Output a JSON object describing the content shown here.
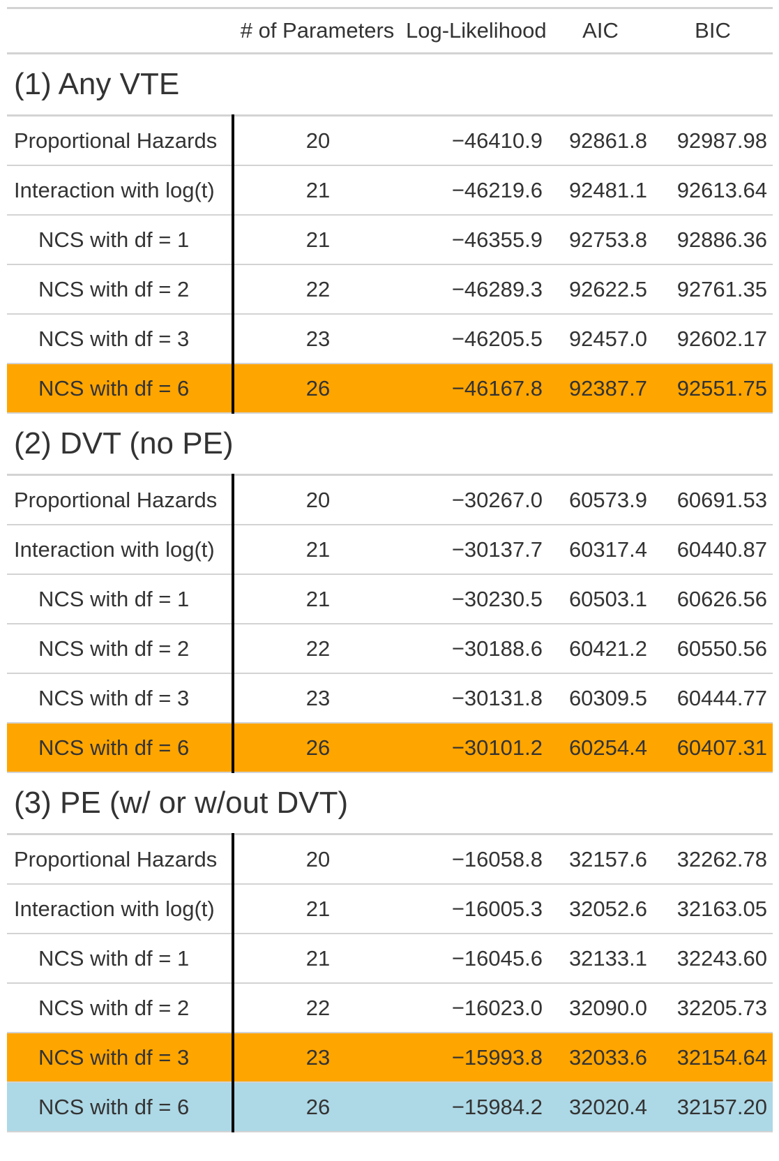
{
  "table": {
    "columns": [
      "",
      "# of Parameters",
      "Log-Likelihood",
      "AIC",
      "BIC"
    ],
    "groups": [
      {
        "title": "(1) Any VTE",
        "rows": [
          {
            "label": "Proportional Hazards",
            "indent": 0,
            "params": "20",
            "loglik": "−46410.9",
            "aic": "92861.8",
            "bic": "92987.98",
            "highlight": ""
          },
          {
            "label": "Interaction with log(t)",
            "indent": 0,
            "params": "21",
            "loglik": "−46219.6",
            "aic": "92481.1",
            "bic": "92613.64",
            "highlight": ""
          },
          {
            "label": "NCS with df = 1",
            "indent": 1,
            "params": "21",
            "loglik": "−46355.9",
            "aic": "92753.8",
            "bic": "92886.36",
            "highlight": ""
          },
          {
            "label": "NCS with df = 2",
            "indent": 1,
            "params": "22",
            "loglik": "−46289.3",
            "aic": "92622.5",
            "bic": "92761.35",
            "highlight": ""
          },
          {
            "label": "NCS with df = 3",
            "indent": 1,
            "params": "23",
            "loglik": "−46205.5",
            "aic": "92457.0",
            "bic": "92602.17",
            "highlight": ""
          },
          {
            "label": "NCS with df = 6",
            "indent": 1,
            "params": "26",
            "loglik": "−46167.8",
            "aic": "92387.7",
            "bic": "92551.75",
            "highlight": "orange"
          }
        ]
      },
      {
        "title": "(2) DVT (no PE)",
        "rows": [
          {
            "label": "Proportional Hazards",
            "indent": 0,
            "params": "20",
            "loglik": "−30267.0",
            "aic": "60573.9",
            "bic": "60691.53",
            "highlight": ""
          },
          {
            "label": "Interaction with log(t)",
            "indent": 0,
            "params": "21",
            "loglik": "−30137.7",
            "aic": "60317.4",
            "bic": "60440.87",
            "highlight": ""
          },
          {
            "label": "NCS with df = 1",
            "indent": 1,
            "params": "21",
            "loglik": "−30230.5",
            "aic": "60503.1",
            "bic": "60626.56",
            "highlight": ""
          },
          {
            "label": "NCS with df = 2",
            "indent": 1,
            "params": "22",
            "loglik": "−30188.6",
            "aic": "60421.2",
            "bic": "60550.56",
            "highlight": ""
          },
          {
            "label": "NCS with df = 3",
            "indent": 1,
            "params": "23",
            "loglik": "−30131.8",
            "aic": "60309.5",
            "bic": "60444.77",
            "highlight": ""
          },
          {
            "label": "NCS with df = 6",
            "indent": 1,
            "params": "26",
            "loglik": "−30101.2",
            "aic": "60254.4",
            "bic": "60407.31",
            "highlight": "orange"
          }
        ]
      },
      {
        "title": "(3) PE (w/ or w/out DVT)",
        "rows": [
          {
            "label": "Proportional Hazards",
            "indent": 0,
            "params": "20",
            "loglik": "−16058.8",
            "aic": "32157.6",
            "bic": "32262.78",
            "highlight": ""
          },
          {
            "label": "Interaction with log(t)",
            "indent": 0,
            "params": "21",
            "loglik": "−16005.3",
            "aic": "32052.6",
            "bic": "32163.05",
            "highlight": ""
          },
          {
            "label": "NCS with df = 1",
            "indent": 1,
            "params": "21",
            "loglik": "−16045.6",
            "aic": "32133.1",
            "bic": "32243.60",
            "highlight": ""
          },
          {
            "label": "NCS with df = 2",
            "indent": 1,
            "params": "22",
            "loglik": "−16023.0",
            "aic": "32090.0",
            "bic": "32205.73",
            "highlight": ""
          },
          {
            "label": "NCS with df = 3",
            "indent": 1,
            "params": "23",
            "loglik": "−15993.8",
            "aic": "32033.6",
            "bic": "32154.64",
            "highlight": "orange"
          },
          {
            "label": "NCS with df = 6",
            "indent": 1,
            "params": "26",
            "loglik": "−15984.2",
            "aic": "32020.4",
            "bic": "32157.20",
            "highlight": "blue"
          }
        ]
      }
    ],
    "colors": {
      "orange": "#ffa500",
      "blue": "#add8e6",
      "rule": "#d3d3d3",
      "text": "#333333"
    }
  }
}
